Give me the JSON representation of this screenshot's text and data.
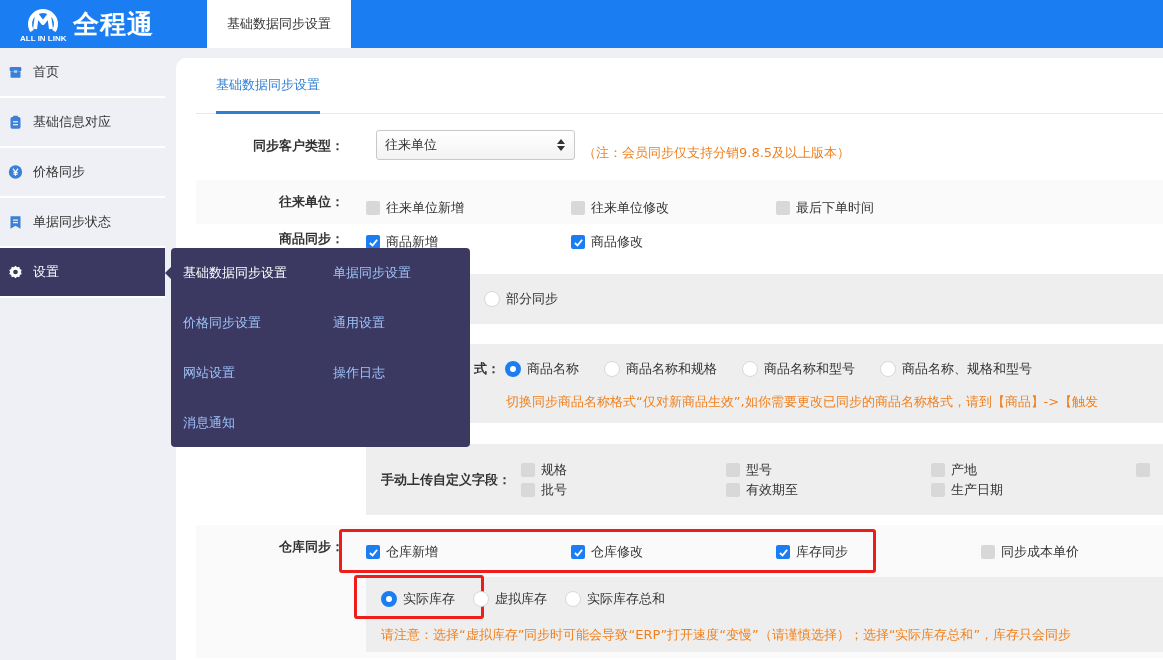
{
  "header": {
    "logo_text": "全程通",
    "logo_subtitle": "ALL IN LINK",
    "tabs": [
      {
        "label": "基础数据同步设置",
        "selected": true
      }
    ]
  },
  "sidebar": {
    "items": [
      {
        "label": "首页",
        "selected": false
      },
      {
        "label": "基础信息对应",
        "selected": false
      },
      {
        "label": "价格同步",
        "selected": false
      },
      {
        "label": "单据同步状态",
        "selected": false
      },
      {
        "label": "设置",
        "selected": true
      }
    ]
  },
  "submenu": {
    "items": [
      {
        "label": "基础数据同步设置",
        "selected": true
      },
      {
        "label": "单据同步设置",
        "selected": false
      },
      {
        "label": "价格同步设置",
        "selected": false
      },
      {
        "label": "通用设置",
        "selected": false
      },
      {
        "label": "网站设置",
        "selected": false
      },
      {
        "label": "操作日志",
        "selected": false
      },
      {
        "label": "消息通知",
        "selected": false
      }
    ]
  },
  "page_tabs": [
    {
      "label": "基础数据同步设置",
      "selected": true
    }
  ],
  "rows": [
    {
      "kind": "select",
      "label": "同步客户类型：",
      "value": "往来单位",
      "note": "（注：会员同步仅支持分销9.8.5及以上版本）"
    },
    {
      "kind": "checks",
      "label": "往来单位：",
      "options": [
        {
          "label": "往来单位新增",
          "checked": false
        },
        {
          "label": "往来单位修改",
          "checked": false
        },
        {
          "label": "最后下单时间",
          "checked": false
        }
      ]
    },
    {
      "kind": "checks",
      "label": "商品同步：",
      "options": [
        {
          "label": "商品新增",
          "checked": true
        },
        {
          "label": "商品修改",
          "checked": true
        }
      ]
    },
    {
      "kind": "mode",
      "options": [
        {
          "label": "部分同步",
          "selected": false
        }
      ]
    },
    {
      "kind": "name_format",
      "label": "式：",
      "options": [
        {
          "label": "商品名称",
          "selected": true
        },
        {
          "label": "商品名称和规格",
          "selected": false
        },
        {
          "label": "商品名称和型号",
          "selected": false
        },
        {
          "label": "商品名称、规格和型号",
          "selected": false
        }
      ],
      "note": "切换同步商品名称格式“仅对新商品生效”,如你需要更改已同步的商品名称格式，请到【商品】->【触发"
    },
    {
      "kind": "fields",
      "label": "手动上传自定义字段：",
      "options": [
        {
          "label": "规格",
          "checked": false
        },
        {
          "label": "型号",
          "checked": false
        },
        {
          "label": "产地",
          "checked": false
        },
        {
          "checked": false
        },
        {
          "label": "批号",
          "checked": false
        },
        {
          "label": "有效期至",
          "checked": false
        },
        {
          "label": "生产日期",
          "checked": false
        }
      ]
    },
    {
      "kind": "warehouse",
      "label": "仓库同步：",
      "options": [
        {
          "label": "仓库新增",
          "checked": true,
          "highlighted": true
        },
        {
          "label": "仓库修改",
          "checked": true,
          "highlighted": true
        },
        {
          "label": "库存同步",
          "checked": true,
          "highlighted": true
        },
        {
          "label": "同步成本单价",
          "checked": false,
          "highlighted": false
        }
      ],
      "stock_options": [
        {
          "label": "实际库存",
          "selected": true,
          "highlighted": true
        },
        {
          "label": "虚拟库存",
          "selected": false,
          "highlighted": false
        },
        {
          "label": "实际库存总和",
          "selected": false,
          "highlighted": false
        }
      ],
      "note": "请注意：选择“虚拟库存”同步时可能会导致“ERP”打开速度“变慢”（请谨慎选择）；选择“实际库存总和”，库存只会同步"
    }
  ]
}
